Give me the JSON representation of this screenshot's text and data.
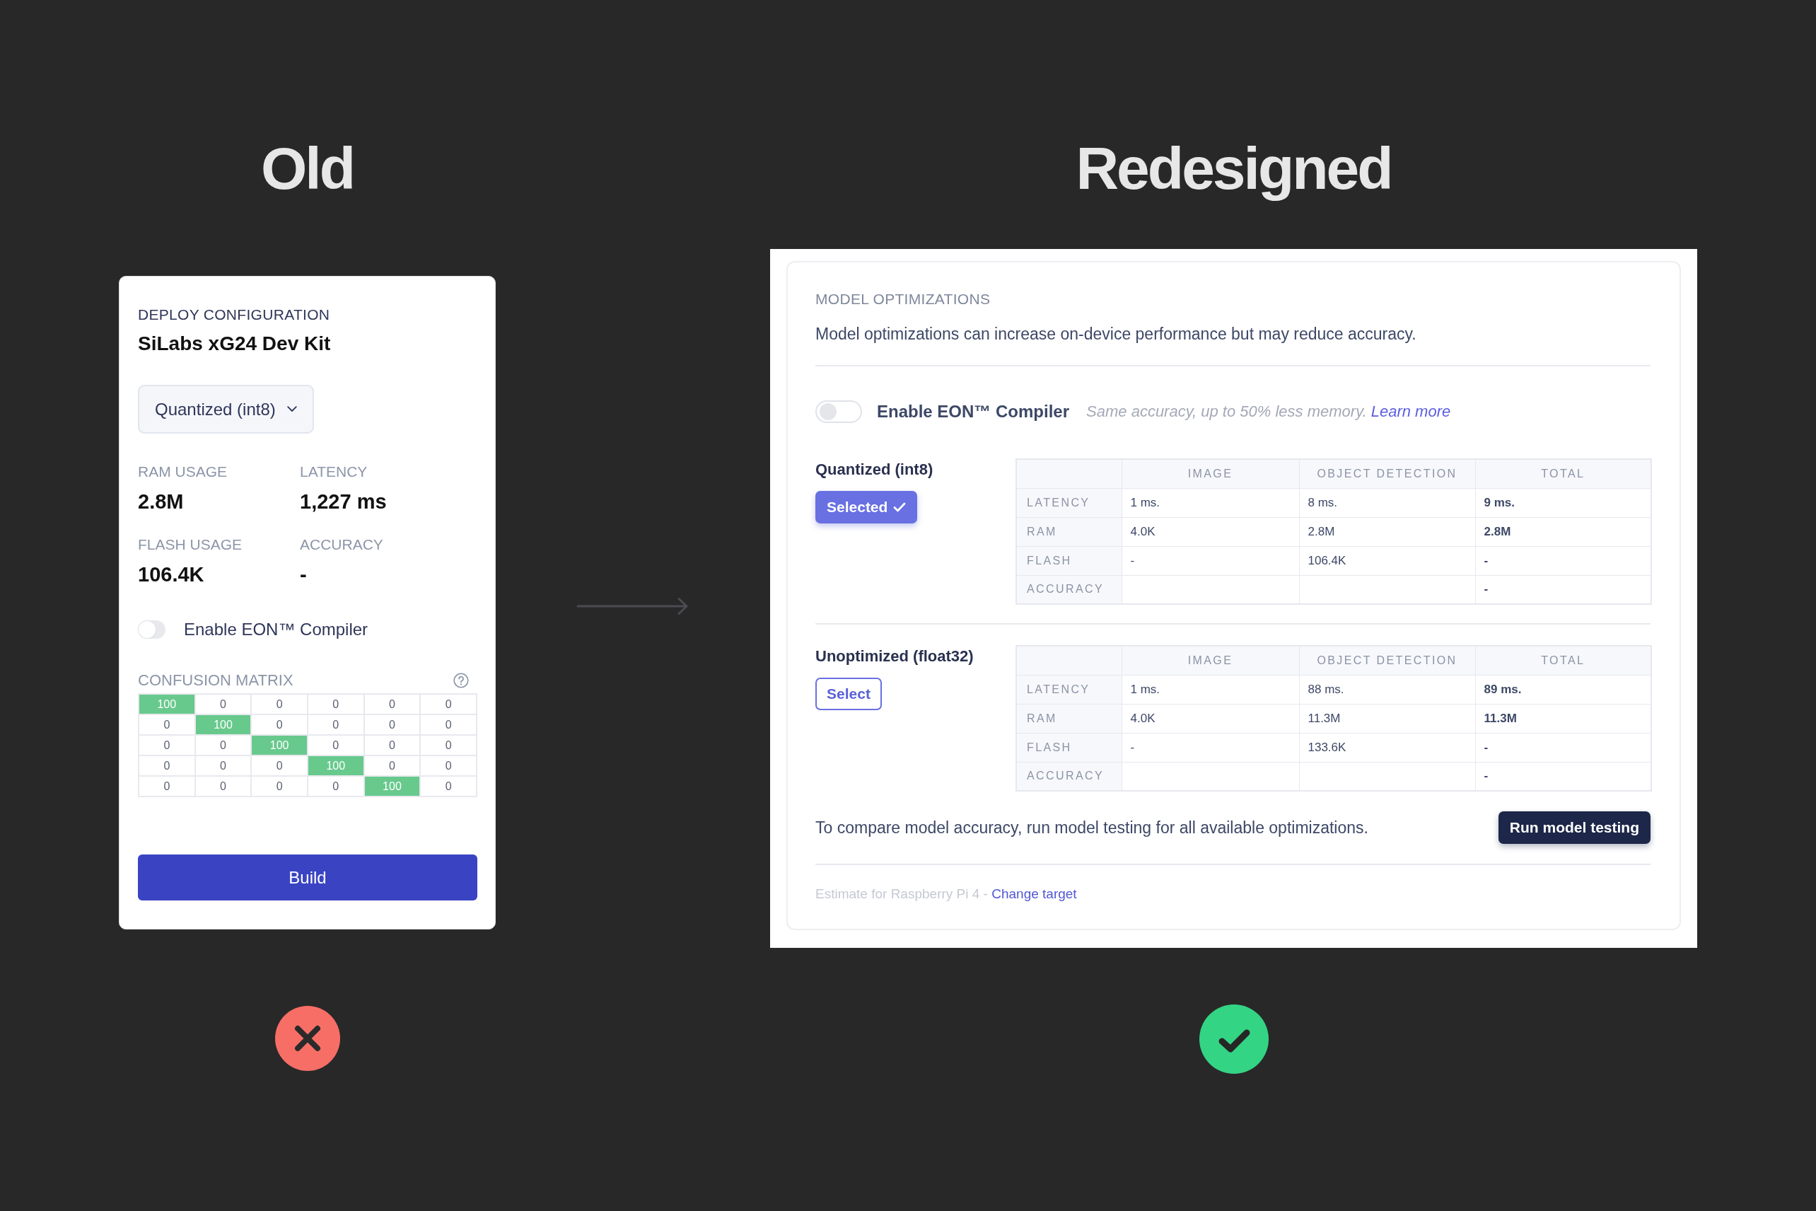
{
  "old": {
    "heading": "Old",
    "approved": false,
    "card": {
      "section_label": "DEPLOY CONFIGURATION",
      "target": "SiLabs xG24 Dev Kit",
      "model_dropdown": {
        "value": "Quantized (int8)"
      },
      "metrics": [
        {
          "label": "RAM USAGE",
          "value": "2.8M"
        },
        {
          "label": "LATENCY",
          "value": "1,227 ms"
        },
        {
          "label": "FLASH USAGE",
          "value": "106.4K"
        },
        {
          "label": "ACCURACY",
          "value": "-"
        }
      ],
      "eon_toggle": {
        "label": "Enable EON™ Compiler",
        "on": false
      },
      "confusion_matrix": {
        "title": "CONFUSION MATRIX",
        "rows": [
          [
            {
              "value": "100",
              "highlighted": true
            },
            {
              "value": "0",
              "highlighted": false
            },
            {
              "value": "0",
              "highlighted": false
            },
            {
              "value": "0",
              "highlighted": false
            },
            {
              "value": "0",
              "highlighted": false
            },
            {
              "value": "0",
              "highlighted": false
            }
          ],
          [
            {
              "value": "0",
              "highlighted": false
            },
            {
              "value": "100",
              "highlighted": true
            },
            {
              "value": "0",
              "highlighted": false
            },
            {
              "value": "0",
              "highlighted": false
            },
            {
              "value": "0",
              "highlighted": false
            },
            {
              "value": "0",
              "highlighted": false
            }
          ],
          [
            {
              "value": "0",
              "highlighted": false
            },
            {
              "value": "0",
              "highlighted": false
            },
            {
              "value": "100",
              "highlighted": true
            },
            {
              "value": "0",
              "highlighted": false
            },
            {
              "value": "0",
              "highlighted": false
            },
            {
              "value": "0",
              "highlighted": false
            }
          ],
          [
            {
              "value": "0",
              "highlighted": false
            },
            {
              "value": "0",
              "highlighted": false
            },
            {
              "value": "0",
              "highlighted": false
            },
            {
              "value": "100",
              "highlighted": true
            },
            {
              "value": "0",
              "highlighted": false
            },
            {
              "value": "0",
              "highlighted": false
            }
          ],
          [
            {
              "value": "0",
              "highlighted": false
            },
            {
              "value": "0",
              "highlighted": false
            },
            {
              "value": "0",
              "highlighted": false
            },
            {
              "value": "0",
              "highlighted": false
            },
            {
              "value": "100",
              "highlighted": true
            },
            {
              "value": "0",
              "highlighted": false
            }
          ]
        ]
      },
      "build_button": "Build"
    }
  },
  "redesigned": {
    "heading": "Redesigned",
    "approved": true,
    "panel": {
      "section_label": "MODEL OPTIMIZATIONS",
      "description": "Model optimizations can increase on-device performance but may reduce accuracy.",
      "eon_toggle": {
        "label": "Enable EON™ Compiler",
        "on": false,
        "hint": "Same accuracy, up to 50% less memory.",
        "link": "Learn more"
      },
      "optimizations": [
        {
          "name": "Quantized (int8)",
          "selected": true,
          "button": "Selected",
          "columns": [
            "IMAGE",
            "OBJECT DETECTION",
            "TOTAL"
          ],
          "rows": [
            {
              "label": "LATENCY",
              "cells": [
                "1 ms.",
                "8 ms.",
                "9 ms."
              ]
            },
            {
              "label": "RAM",
              "cells": [
                "4.0K",
                "2.8M",
                "2.8M"
              ]
            },
            {
              "label": "FLASH",
              "cells": [
                "-",
                "106.4K",
                "-"
              ]
            },
            {
              "label": "ACCURACY",
              "cells": [
                null,
                null,
                "-"
              ]
            }
          ]
        },
        {
          "name": "Unoptimized (float32)",
          "selected": false,
          "button": "Select",
          "columns": [
            "IMAGE",
            "OBJECT DETECTION",
            "TOTAL"
          ],
          "rows": [
            {
              "label": "LATENCY",
              "cells": [
                "1 ms.",
                "88 ms.",
                "89 ms."
              ]
            },
            {
              "label": "RAM",
              "cells": [
                "4.0K",
                "11.3M",
                "11.3M"
              ]
            },
            {
              "label": "FLASH",
              "cells": [
                "-",
                "133.6K",
                "-"
              ]
            },
            {
              "label": "ACCURACY",
              "cells": [
                null,
                null,
                "-"
              ]
            }
          ]
        }
      ],
      "compare_note": "To compare model accuracy, run model testing for all available optimizations.",
      "run_button": "Run model testing",
      "footer": {
        "text": "Estimate for Raspberry Pi 4 -",
        "link": "Change target"
      }
    }
  }
}
